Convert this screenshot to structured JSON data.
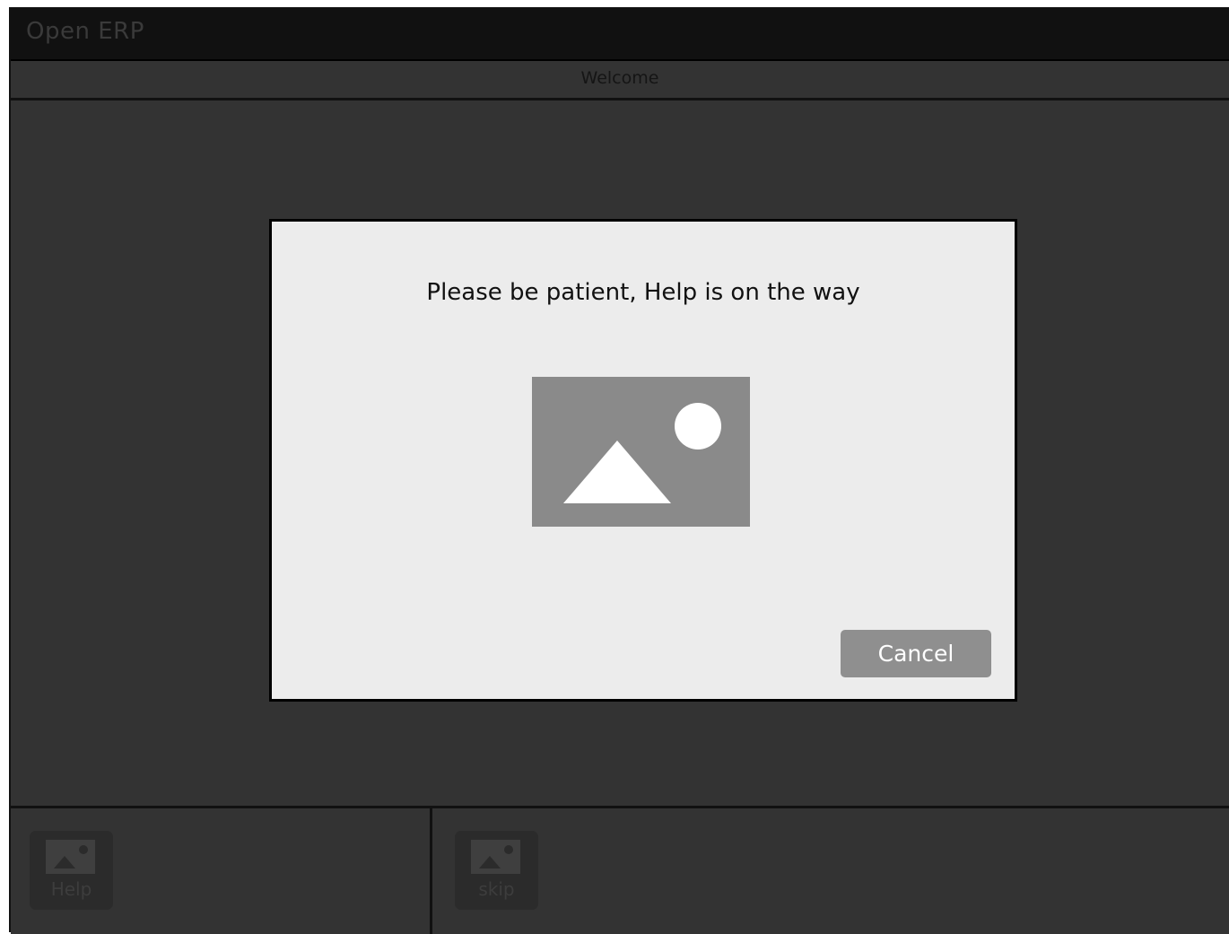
{
  "app": {
    "title": "Open ERP"
  },
  "tabbar": {
    "label": "Welcome"
  },
  "modal": {
    "message": "Please be patient, Help is on the way",
    "image_icon": "image-placeholder-icon",
    "cancel_label": "Cancel"
  },
  "toolbar": {
    "help": {
      "label": "Help",
      "icon": "image-icon"
    },
    "skip": {
      "label": "skip",
      "icon": "image-icon"
    }
  },
  "colors": {
    "background": "#333333",
    "titlebar": "#111111",
    "modal": "#ececec",
    "placeholder": "#8a8a8a",
    "button": "#8f8f8f"
  }
}
